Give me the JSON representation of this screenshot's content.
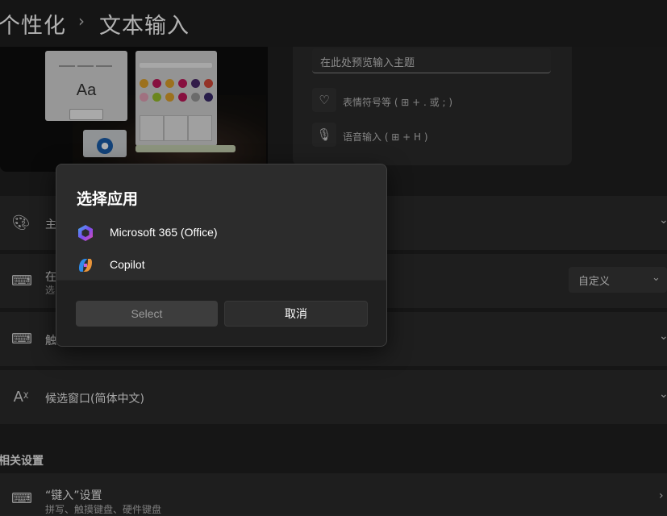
{
  "breadcrumb": {
    "parent": "个性化",
    "separator": "›",
    "current": "文本输入"
  },
  "preview": {
    "keyboard_sample": "Aa",
    "emoji_colors": [
      "#e0a32b",
      "#c2185b",
      "#e0a32b",
      "#c2185b",
      "#4a2a6a",
      "#d44a3a",
      "#e6a3b8",
      "#9ac02a",
      "#e0a32b",
      "#c2185b",
      "#9a9a9a",
      "#3a2a6a"
    ]
  },
  "theme_preview": {
    "input_placeholder": "在此处预览输入主题",
    "emoji_row": "表情符号等 ( ⊞ + . 或 ; )",
    "voice_row": "语音输入 ( ⊞ + H )"
  },
  "rows": {
    "theme": {
      "title": "主"
    },
    "touch_keyboard": {
      "title": "在",
      "subtitle": "选",
      "dropdown_value": "自定义"
    },
    "touch": {
      "title": "触"
    },
    "candidate": {
      "title": "候选窗口(简体中文)"
    }
  },
  "related": {
    "section_title": "相关设置",
    "typing": {
      "title": "“键入”设置",
      "subtitle": "拼写、触摸键盘、硬件键盘"
    }
  },
  "dialog": {
    "title": "选择应用",
    "apps": [
      {
        "label": "Microsoft 365 (Office)",
        "icon": "microsoft-365-icon"
      },
      {
        "label": "Copilot",
        "icon": "copilot-icon"
      }
    ],
    "select_label": "Select",
    "cancel_label": "取消"
  }
}
